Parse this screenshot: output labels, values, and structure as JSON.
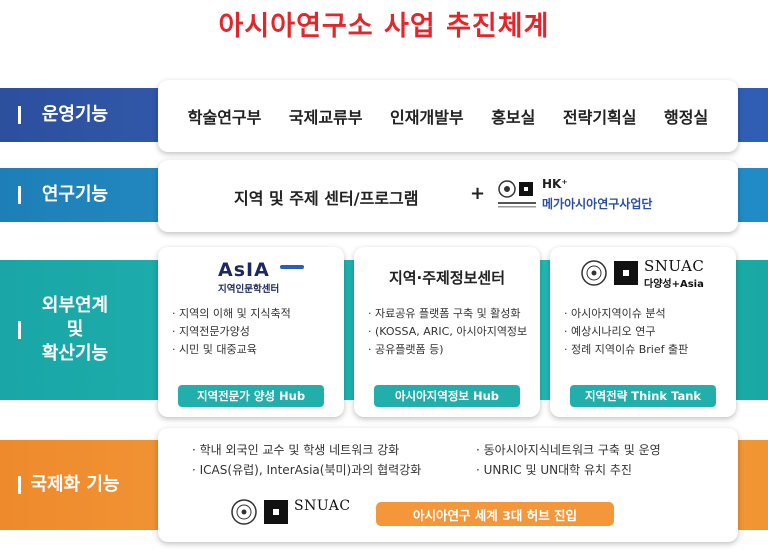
{
  "title": "아시아연구소 사업 추진체계",
  "rows": {
    "operation": {
      "label": "운영기능",
      "items": [
        "학술연구부",
        "국제교류부",
        "인재개발부",
        "홍보실",
        "전략기획실",
        "행정실"
      ]
    },
    "research": {
      "label": "연구기능",
      "program": "지역 및 주제 센터/프로그램",
      "plus": "+",
      "hk_title": "HK⁺",
      "hk_org": "SNUAC",
      "hk_name": "메가아시아연구사업단"
    },
    "outreach": {
      "label_lines": [
        "외부연계",
        "및",
        "확산기능"
      ],
      "cards": [
        {
          "logo_word": "AsIA",
          "logo_sub": "지역인문학센터",
          "bullets": [
            "지역의 이해 및 지식축적",
            "지역전문가양성",
            "시민 및 대중교육"
          ],
          "hub": "지역전문가 양성 Hub"
        },
        {
          "heading": "지역·주제정보센터",
          "bullets": [
            "자료공유 플랫폼 구축 및 활성화",
            "(KOSSA, ARIC, 아시아지역정보",
            "공유플랫폼 등)"
          ],
          "hub": "아시아지역정보 Hub"
        },
        {
          "logo_word": "SNUAC",
          "logo_sub": "다양성+Asia",
          "bullets": [
            "아시아지역이슈 분석",
            "예상시나리오 연구",
            "정례 지역이슈 Brief 출판"
          ],
          "hub": "지역전략 Think Tank"
        }
      ]
    },
    "international": {
      "label": "국제화 기능",
      "left": [
        "학내 외국인 교수 및 학생 네트워크 강화",
        "ICAS(유럽), InterAsia(북미)과의 협력강화"
      ],
      "right": [
        "동아시아지식네트워크 구축 및 운영",
        "UNRIC 및 UN대학 유치 추진"
      ],
      "logo_word": "SNUAC",
      "goal": "아시아연구 세계 3대 허브 진입"
    }
  },
  "colors": {
    "title": "#e3262c",
    "operation": "#2c4f9e",
    "research": "#1e7fb8",
    "outreach": "#1aa6a6",
    "international": "#ee8a2c"
  }
}
